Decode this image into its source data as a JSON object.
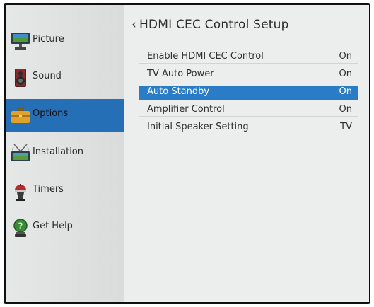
{
  "sidebar": {
    "items": [
      {
        "label": "Picture",
        "icon": "picture-icon"
      },
      {
        "label": "Sound",
        "icon": "speaker-icon"
      },
      {
        "label": "Options",
        "icon": "options-toolbox-icon",
        "selected": true
      },
      {
        "label": "Installation",
        "icon": "antenna-icon"
      },
      {
        "label": "Timers",
        "icon": "timer-icon"
      },
      {
        "label": "Get Help",
        "icon": "help-icon"
      }
    ]
  },
  "main": {
    "back_icon": "‹",
    "title": "HDMI CEC Control Setup",
    "settings": [
      {
        "label": "Enable HDMI CEC  Control",
        "value": "On"
      },
      {
        "label": "TV Auto Power",
        "value": "On"
      },
      {
        "label": "Auto Standby",
        "value": "On",
        "selected": true
      },
      {
        "label": "Amplifier Control",
        "value": "On"
      },
      {
        "label": "Initial Speaker Setting",
        "value": "TV"
      }
    ]
  },
  "colors": {
    "selection": "#2a7cc6",
    "sidebar_selection": "#246fb6",
    "panel_background": "#eceeee",
    "bezel": "#101010"
  }
}
